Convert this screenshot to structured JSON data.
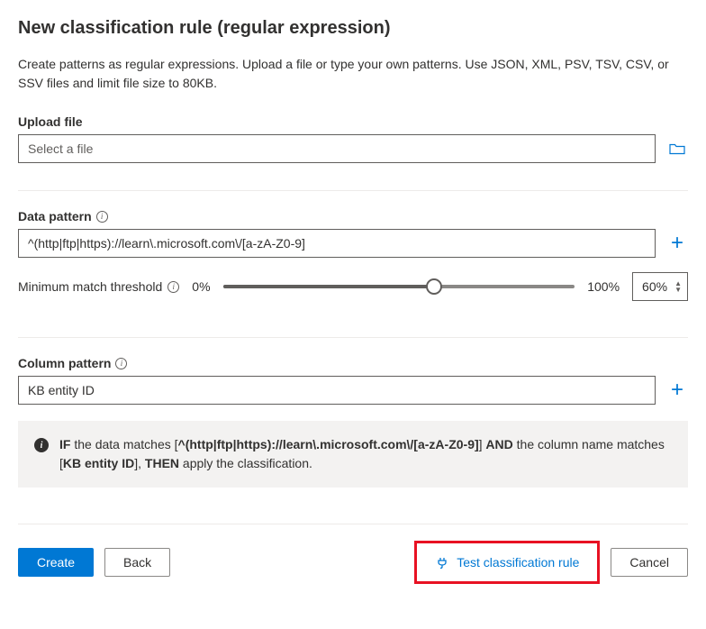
{
  "title": "New classification rule (regular expression)",
  "description": "Create patterns as regular expressions. Upload a file or type your own patterns. Use JSON, XML, PSV, TSV, CSV, or SSV files and limit file size to 80KB.",
  "upload": {
    "label": "Upload file",
    "placeholder": "Select a file"
  },
  "dataPattern": {
    "label": "Data pattern",
    "value": "^(http|ftp|https)://learn\\.microsoft.com\\/[a-zA-Z0-9]"
  },
  "threshold": {
    "label": "Minimum match threshold",
    "min": "0%",
    "max": "100%",
    "value": "60%",
    "percent": 60
  },
  "columnPattern": {
    "label": "Column pattern",
    "value": "KB entity ID"
  },
  "summary": {
    "prefix": "IF",
    "text1": " the data matches [",
    "dataBold": "^(http|ftp|https)://learn\\.microsoft.com\\/[a-zA-Z0-9]",
    "text2": "] ",
    "and": "AND",
    "text3": " the column name matches [",
    "colBold": "KB entity ID",
    "text4": "], ",
    "then": "THEN",
    "text5": " apply the classification."
  },
  "buttons": {
    "create": "Create",
    "back": "Back",
    "test": "Test classification rule",
    "cancel": "Cancel"
  }
}
